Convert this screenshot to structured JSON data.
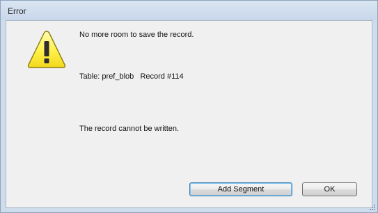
{
  "window": {
    "title": "Error"
  },
  "dialog": {
    "icon": "warning-icon",
    "message": "No more room to save the record.",
    "detail": "Table: pref_blob   Record #114",
    "status": "The record cannot be written."
  },
  "buttons": {
    "add_segment_label": "Add Segment",
    "ok_label": "OK"
  },
  "colors": {
    "warning_fill": "#fff25a",
    "warning_stroke": "#8a7a10",
    "client_background": "#f0f0f0",
    "frame_background": "#cfdcec"
  }
}
